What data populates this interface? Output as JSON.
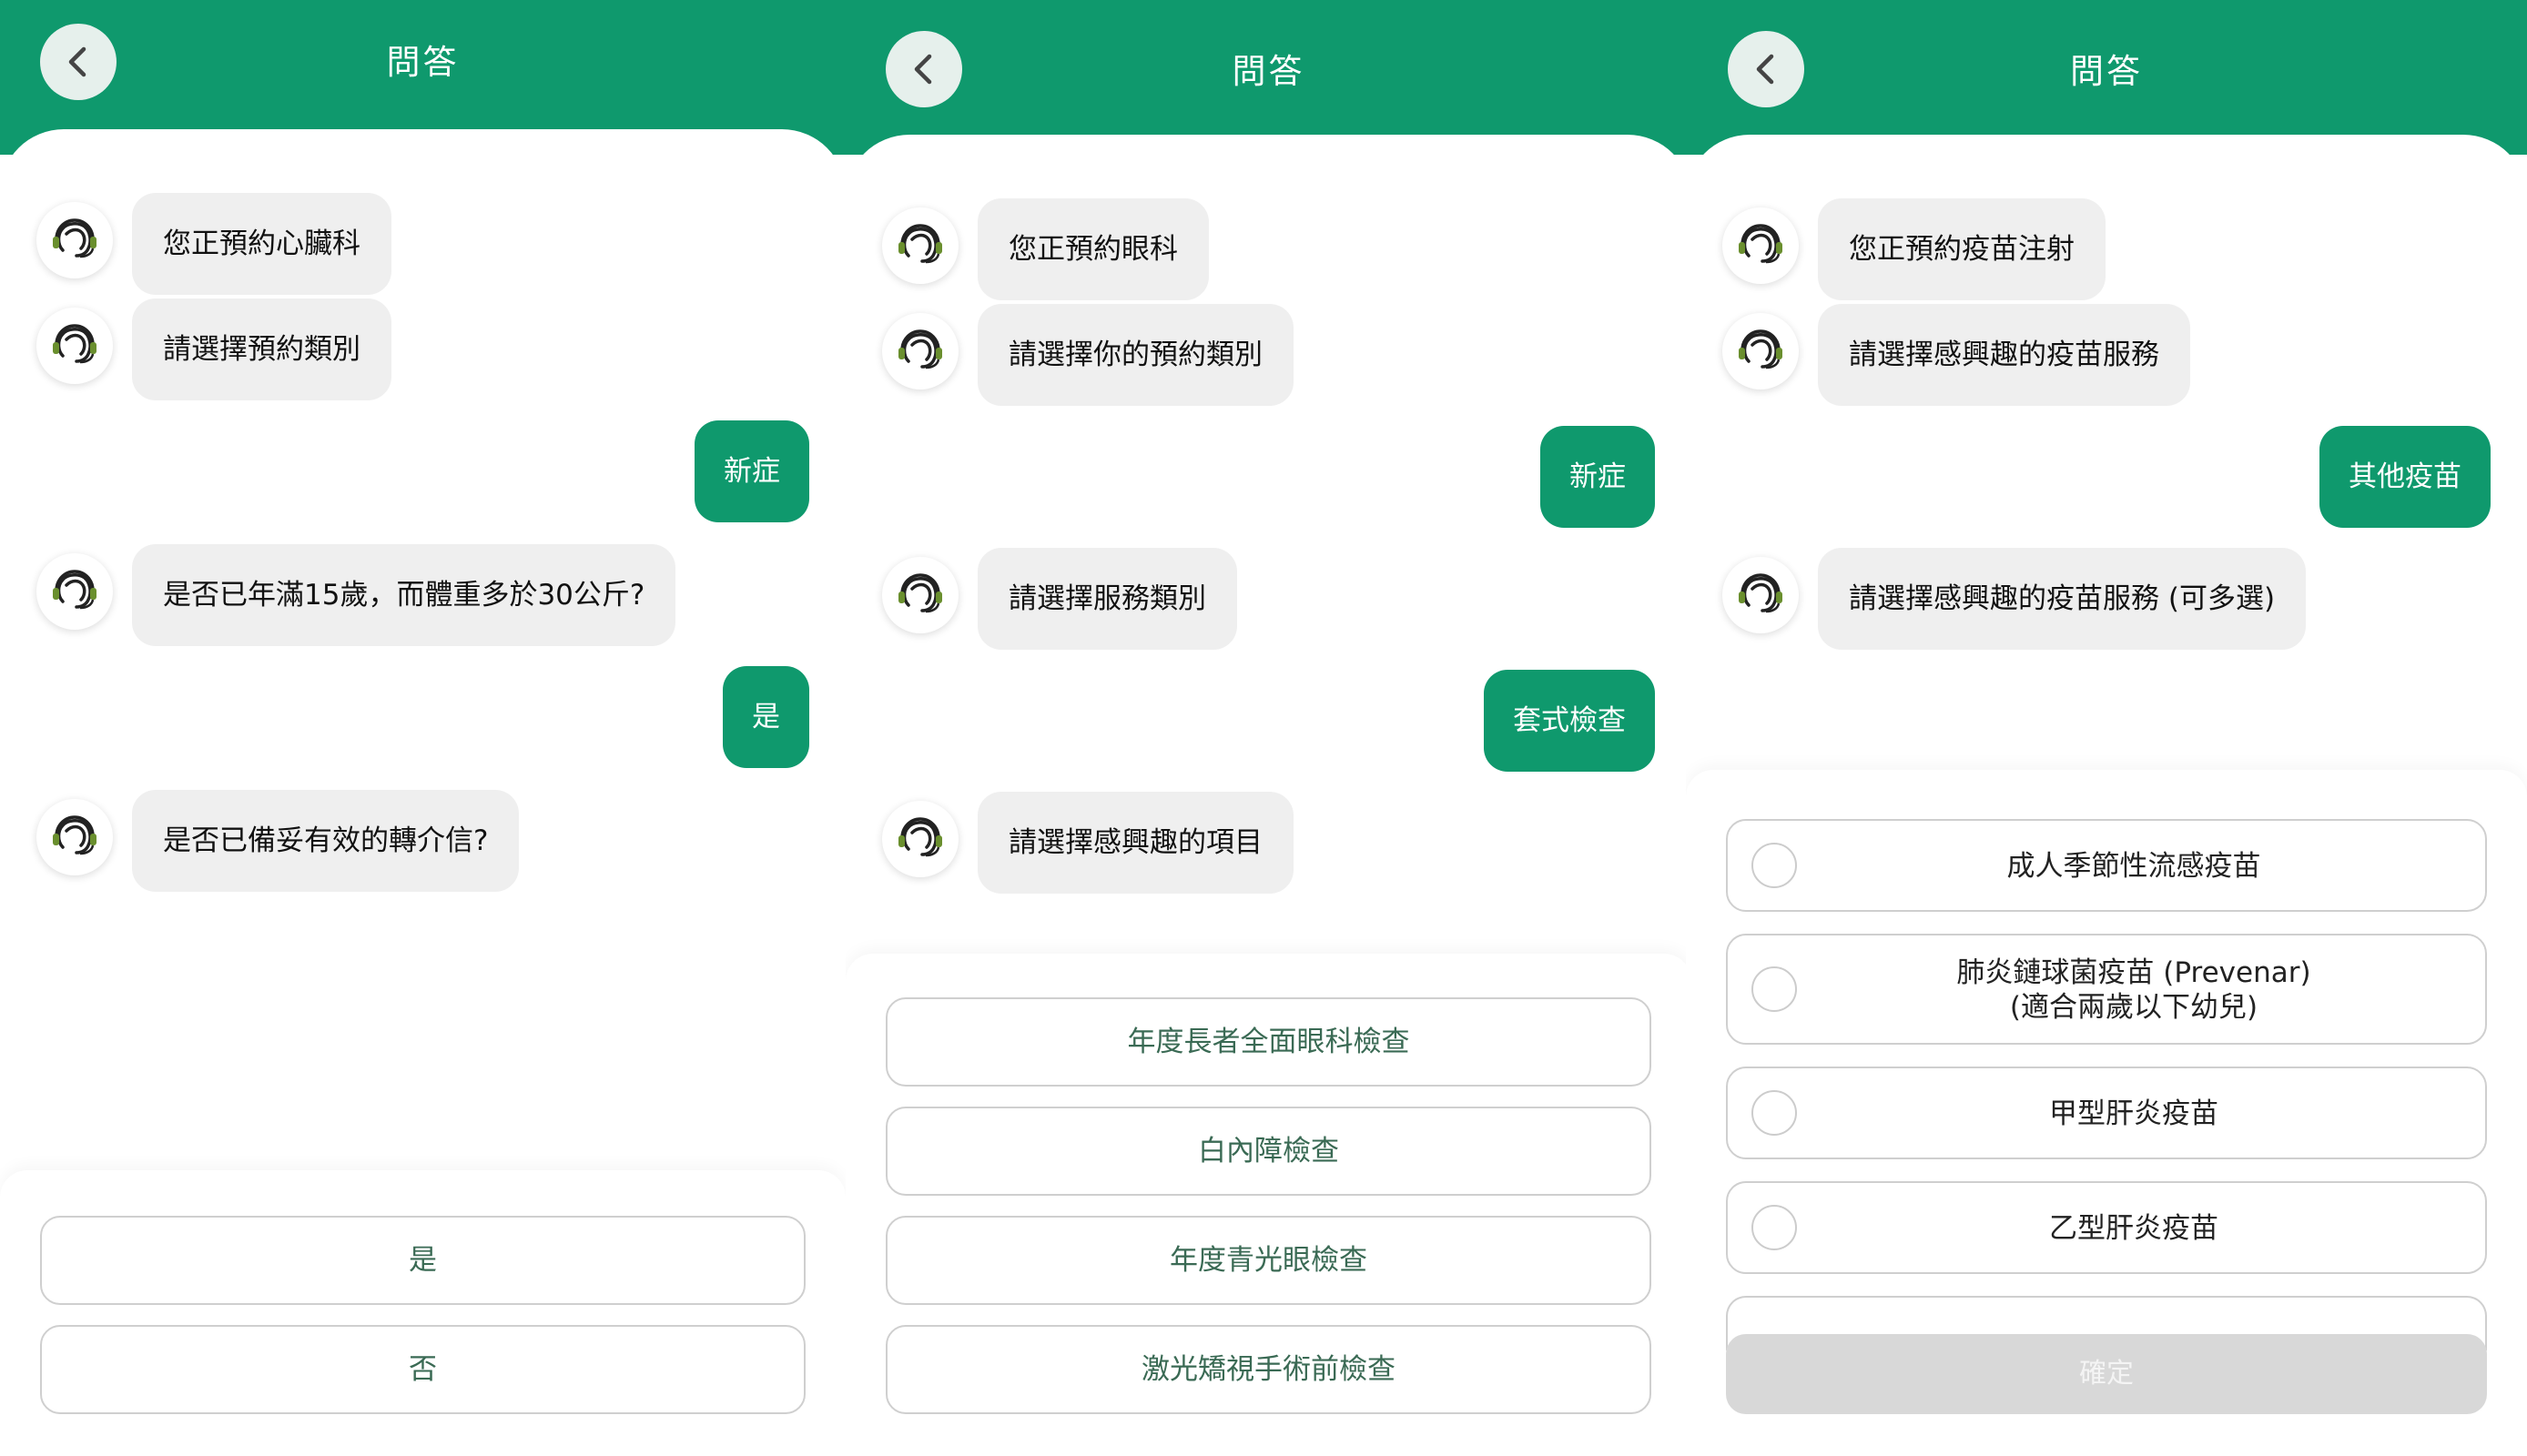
{
  "colors": {
    "brand": "#0f996d",
    "bubble": "#efefef",
    "border": "#cfcfcf",
    "disabled": "#d8d8d8"
  },
  "icons": {
    "back": "chevron-left-icon",
    "agent": "headset-agent-icon",
    "radio": "radio-circle"
  },
  "panels": [
    {
      "title": "問答",
      "messages": [
        "您正預約心臟科",
        "請選擇預約類別",
        "是否已年滿15歲，而體重多於30公斤?",
        "是否已備妥有效的轉介信?"
      ],
      "replies": [
        "新症",
        "是"
      ],
      "options": [
        "是",
        "否"
      ]
    },
    {
      "title": "問答",
      "messages": [
        "您正預約眼科",
        "請選擇你的預約類別",
        "請選擇服務類別",
        "請選擇感興趣的項目"
      ],
      "replies": [
        "新症",
        "套式檢查"
      ],
      "options": [
        "年度長者全面眼科檢查",
        "白內障檢查",
        "年度青光眼檢查",
        "激光矯視手術前檢查"
      ]
    },
    {
      "title": "問答",
      "messages": [
        "您正預約疫苗注射",
        "請選擇感興趣的疫苗服務",
        "請選擇感興趣的疫苗服務 (可多選)"
      ],
      "replies": [
        "其他疫苗"
      ],
      "options": [
        [
          "成人季節性流感疫苗"
        ],
        [
          "肺炎鏈球菌疫苗 (Prevenar)",
          "(適合兩歲以下幼兒)"
        ],
        [
          "甲型肝炎疫苗"
        ],
        [
          "乙型肝炎疫苗"
        ]
      ],
      "confirm": "確定"
    }
  ]
}
